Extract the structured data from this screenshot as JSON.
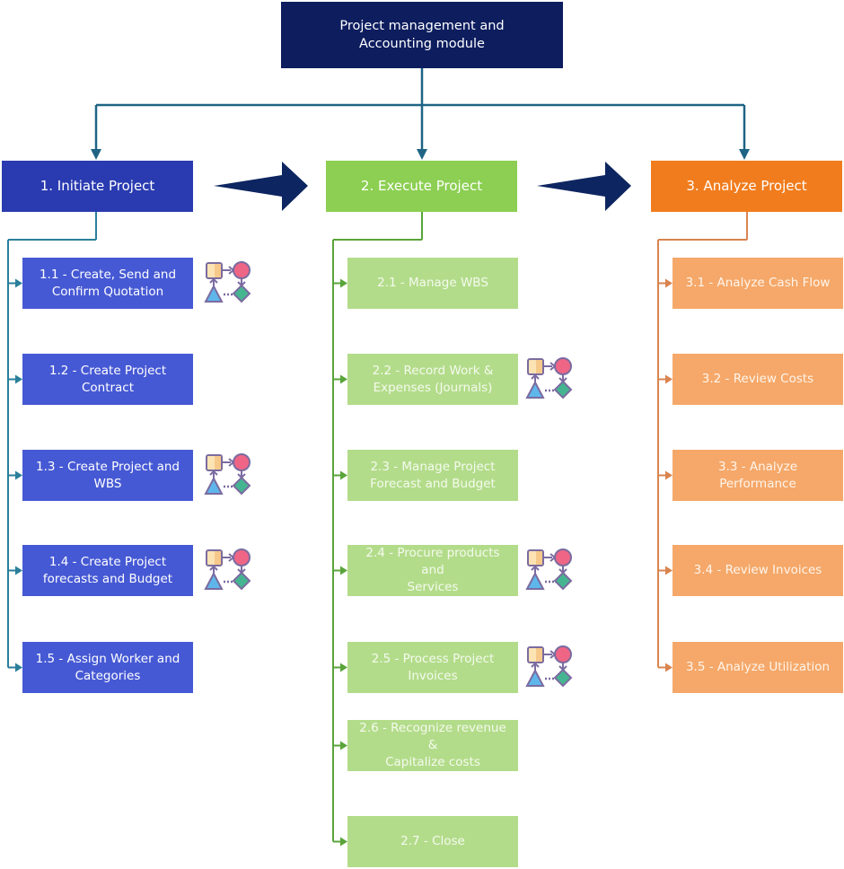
{
  "root": {
    "title_line1": "Project management and",
    "title_line2": "Accounting module"
  },
  "phases": [
    {
      "label": "1. Initiate Project",
      "color": "#2a3bb1",
      "line_color": "#2a7f9a"
    },
    {
      "label": "2. Execute Project",
      "color": "#8ccf52",
      "line_color": "#5aa43a"
    },
    {
      "label": "3. Analyze Project",
      "color": "#f17c1d",
      "line_color": "#d98450"
    }
  ],
  "steps": {
    "initiate": [
      {
        "line1": "1.1 -  Create, Send and",
        "line2": "Confirm Quotation",
        "workflow_icon": true
      },
      {
        "line1": "1.2 - Create Project",
        "line2": "Contract",
        "workflow_icon": false
      },
      {
        "line1": "1.3 - Create Project and",
        "line2": "WBS",
        "workflow_icon": true
      },
      {
        "line1": "1.4 - Create Project",
        "line2": "forecasts and Budget",
        "workflow_icon": true
      },
      {
        "line1": "1.5 - Assign Worker and",
        "line2": "Categories",
        "workflow_icon": false
      }
    ],
    "execute": [
      {
        "line1": "2.1 - Manage WBS",
        "line2": "",
        "workflow_icon": false
      },
      {
        "line1": "2.2 - Record Work &",
        "line2": "Expenses (Journals)",
        "workflow_icon": true
      },
      {
        "line1": "2.3 - Manage Project",
        "line2": "Forecast and Budget",
        "workflow_icon": false
      },
      {
        "line1": "2.4 - Procure products and",
        "line2": "Services",
        "workflow_icon": true
      },
      {
        "line1": "2.5 - Process Project",
        "line2": "Invoices",
        "workflow_icon": true
      },
      {
        "line1": "2.6 - Recognize revenue &",
        "line2": "Capitalize costs",
        "workflow_icon": false
      },
      {
        "line1": "2.7 - Close",
        "line2": "",
        "workflow_icon": false
      }
    ],
    "analyze": [
      {
        "line1": "3.1 - Analyze Cash Flow",
        "line2": "",
        "workflow_icon": false
      },
      {
        "line1": "3.2 - Review Costs",
        "line2": "",
        "workflow_icon": false
      },
      {
        "line1": "3.3 - Analyze",
        "line2": "Performance",
        "workflow_icon": false
      },
      {
        "line1": "3.4 - Review Invoices",
        "line2": "",
        "workflow_icon": false
      },
      {
        "line1": "3.5 - Analyze Utilization",
        "line2": "",
        "workflow_icon": false
      }
    ]
  },
  "colors": {
    "root": "#0d1d5e",
    "connector_top": "#1f6485",
    "flow_arrow": "#0d2560"
  }
}
